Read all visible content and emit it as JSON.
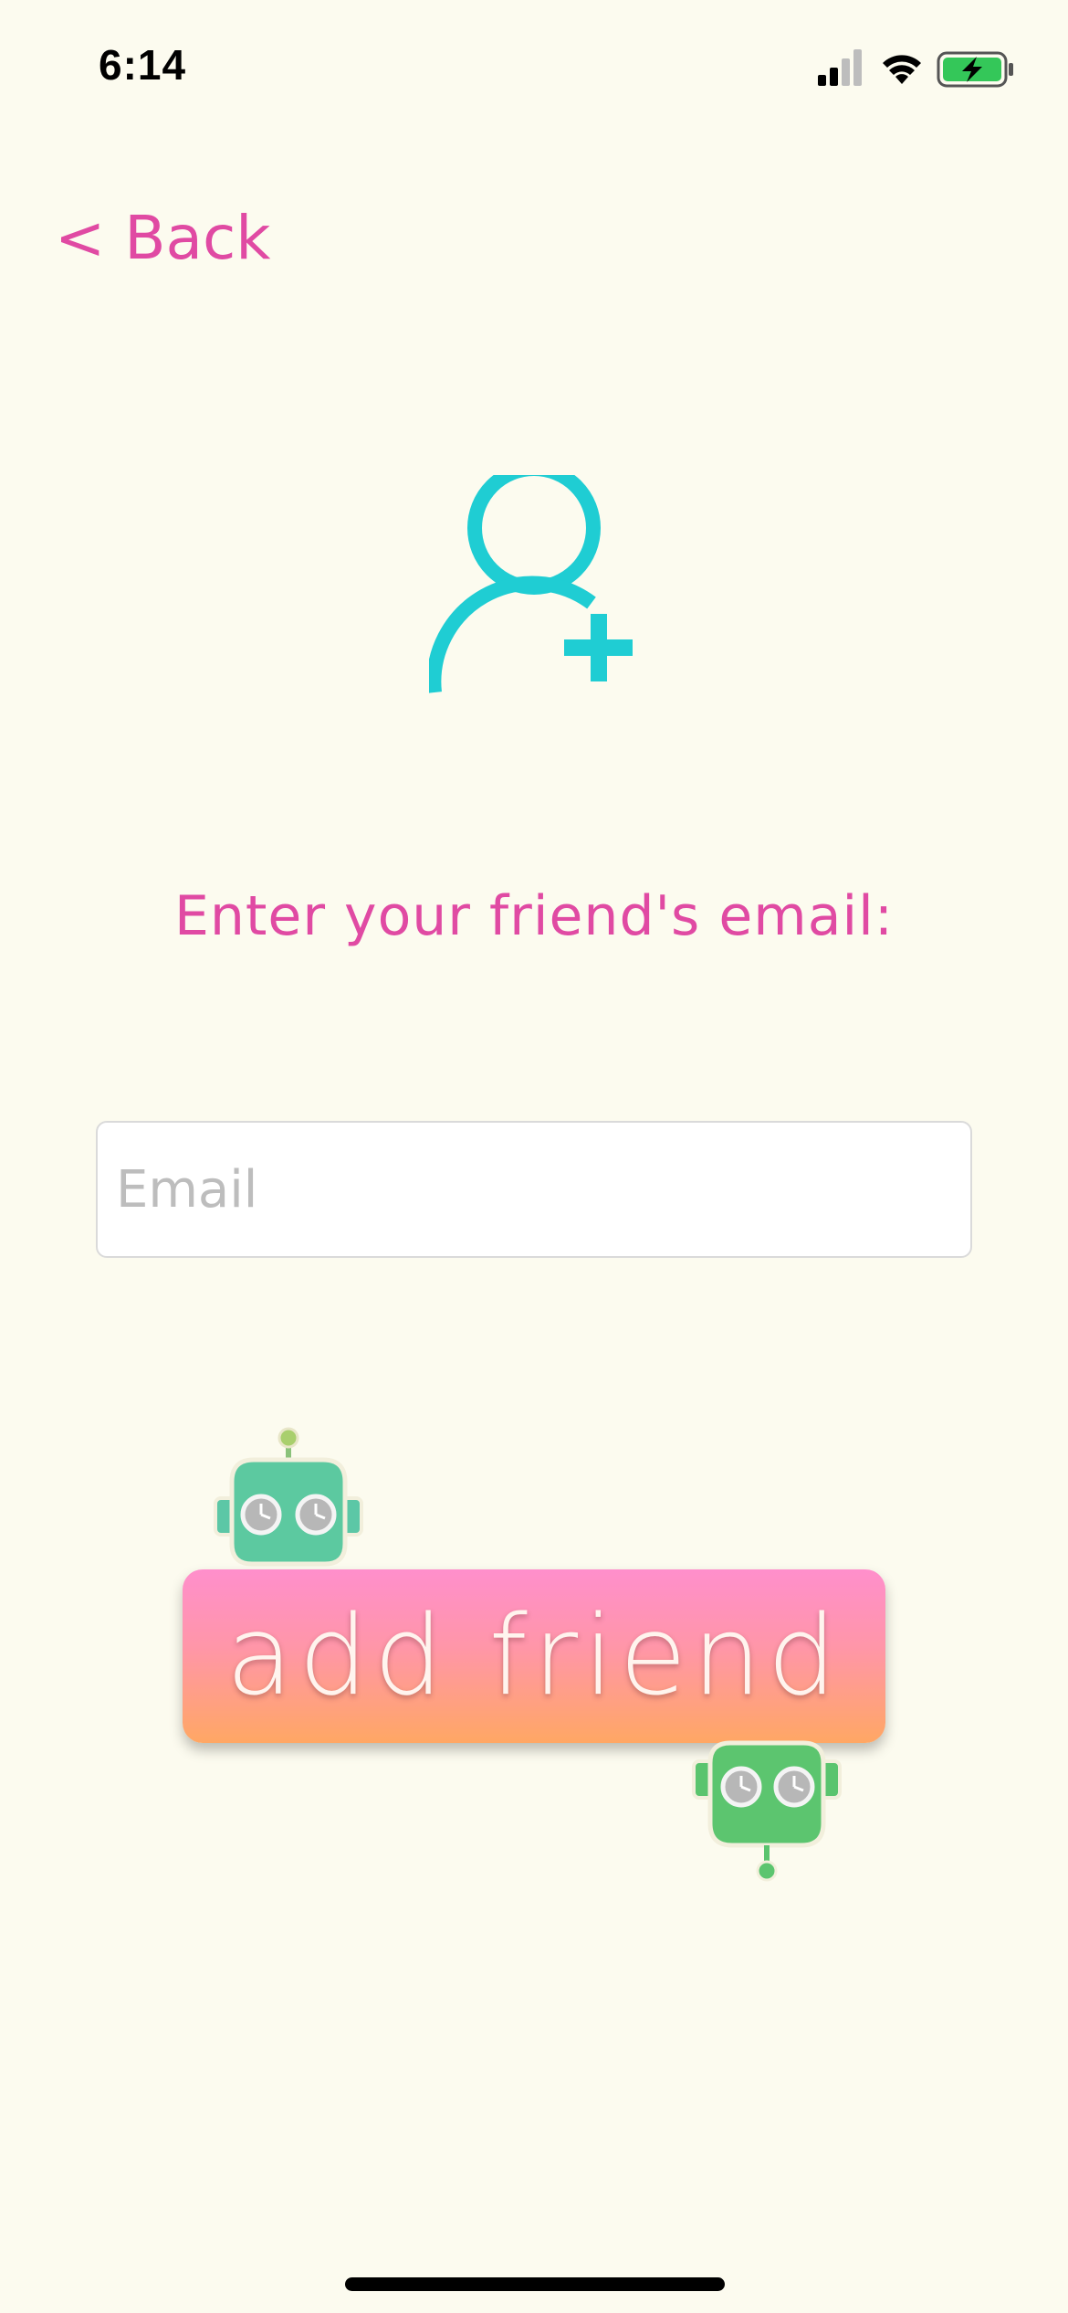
{
  "status_bar": {
    "time": "6:14",
    "signal_icon": "cellular-signal-icon",
    "wifi_icon": "wifi-icon",
    "battery_icon": "battery-charging-icon",
    "battery_color": "#34c759"
  },
  "nav": {
    "back_label": "< Back"
  },
  "hero": {
    "icon": "add-user-icon",
    "icon_color": "#1fcdd3"
  },
  "form": {
    "prompt": "Enter your friend's email:",
    "email_placeholder": "Email",
    "email_value": ""
  },
  "actions": {
    "add_friend_label": "add friend"
  },
  "theme": {
    "background": "#fcfbef",
    "accent_pink": "#e04aa3",
    "button_gradient_top": "#ff8fcc",
    "button_gradient_bottom": "#ffa764"
  }
}
